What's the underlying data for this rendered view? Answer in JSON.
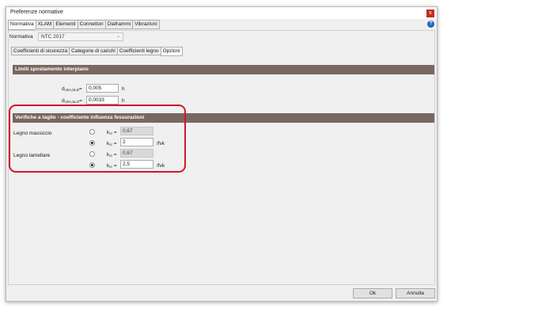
{
  "window": {
    "title": "Preferenze normative",
    "close_glyph": "x",
    "help_glyph": "?"
  },
  "outer_tabs": [
    "Normativa",
    "XLAM",
    "Elementi",
    "Connettori",
    "Diaframmi",
    "Vibrazioni"
  ],
  "normativa": {
    "label": "Normativa",
    "value": "NTC 2017",
    "chevron": "⌄"
  },
  "inner_tabs": [
    "Coefficienti di sicurezza",
    "Categorie di carichi",
    "Coefficienti legno",
    "Opzioni"
  ],
  "limiti": {
    "header": "Limiti spostamento interpiano",
    "sld_label_main": "d",
    "sld_label_sub": "r,lim,SLD",
    "sld_label_eq": "=",
    "sld_value": "0,005",
    "sld_unit": "h",
    "slo_label_main": "d",
    "slo_label_sub": "r,lim,SLO",
    "slo_label_eq": "=",
    "slo_value": "0,0033",
    "slo_unit": "h"
  },
  "verifiche": {
    "header": "Verifiche a taglio - coefficiente influenza fessurazioni",
    "kcr_main": "k",
    "kcr_sub": "cr",
    "kcr_eq": " =",
    "groups": [
      {
        "label": "Legno massiccio",
        "fixed_value": "0,67",
        "custom_value": "2",
        "custom_unit": "/fvk",
        "selected": "custom"
      },
      {
        "label": "Legno lamellare",
        "fixed_value": "0,67",
        "custom_value": "2,5",
        "custom_unit": "/fvk",
        "selected": "custom"
      }
    ]
  },
  "buttons": {
    "ok": "Ok",
    "cancel": "Annulla"
  },
  "colors": {
    "section_header": "#7a6761",
    "highlight": "#d01824",
    "close": "#c42b1c"
  }
}
